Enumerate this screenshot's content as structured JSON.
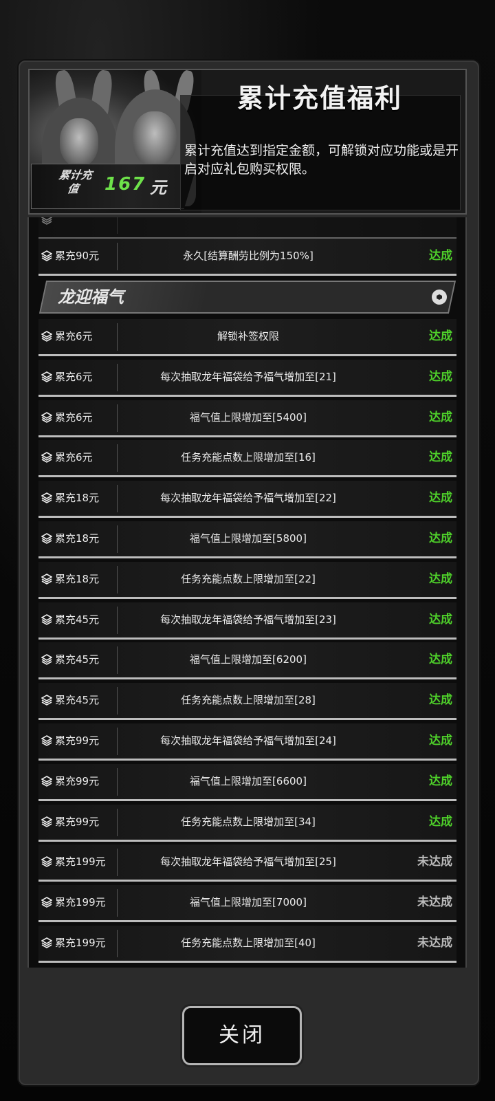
{
  "header": {
    "title": "累计充值福利",
    "description": "累计充值达到指定金额，可解锁对应功能或是开启对应礼包购买权限。",
    "total_label": "累计充值",
    "total_amount": "167",
    "total_unit": "元"
  },
  "partial_row": {
    "amount": "累充90元",
    "effect": "永久[结算酬劳比例为150%]",
    "status": "达成"
  },
  "section": {
    "title": "龙迎福气"
  },
  "rows": [
    {
      "amount": "累充6元",
      "effect": "解锁补签权限",
      "status": "达成",
      "done": true
    },
    {
      "amount": "累充6元",
      "effect": "每次抽取龙年福袋给予福气增加至[21]",
      "status": "达成",
      "done": true
    },
    {
      "amount": "累充6元",
      "effect": "福气值上限增加至[5400]",
      "status": "达成",
      "done": true
    },
    {
      "amount": "累充6元",
      "effect": "任务充能点数上限增加至[16]",
      "status": "达成",
      "done": true
    },
    {
      "amount": "累充18元",
      "effect": "每次抽取龙年福袋给予福气增加至[22]",
      "status": "达成",
      "done": true
    },
    {
      "amount": "累充18元",
      "effect": "福气值上限增加至[5800]",
      "status": "达成",
      "done": true
    },
    {
      "amount": "累充18元",
      "effect": "任务充能点数上限增加至[22]",
      "status": "达成",
      "done": true
    },
    {
      "amount": "累充45元",
      "effect": "每次抽取龙年福袋给予福气增加至[23]",
      "status": "达成",
      "done": true
    },
    {
      "amount": "累充45元",
      "effect": "福气值上限增加至[6200]",
      "status": "达成",
      "done": true
    },
    {
      "amount": "累充45元",
      "effect": "任务充能点数上限增加至[28]",
      "status": "达成",
      "done": true
    },
    {
      "amount": "累充99元",
      "effect": "每次抽取龙年福袋给予福气增加至[24]",
      "status": "达成",
      "done": true
    },
    {
      "amount": "累充99元",
      "effect": "福气值上限增加至[6600]",
      "status": "达成",
      "done": true
    },
    {
      "amount": "累充99元",
      "effect": "任务充能点数上限增加至[34]",
      "status": "达成",
      "done": true
    },
    {
      "amount": "累充199元",
      "effect": "每次抽取龙年福袋给予福气增加至[25]",
      "status": "未达成",
      "done": false
    },
    {
      "amount": "累充199元",
      "effect": "福气值上限增加至[7000]",
      "status": "未达成",
      "done": false
    },
    {
      "amount": "累充199元",
      "effect": "任务充能点数上限增加至[40]",
      "status": "未达成",
      "done": false
    }
  ],
  "close_button": {
    "label": "关闭"
  },
  "colors": {
    "done": "#4ed02a",
    "not_done": "#bbbbbb",
    "amount_accent": "#6ee24a"
  }
}
